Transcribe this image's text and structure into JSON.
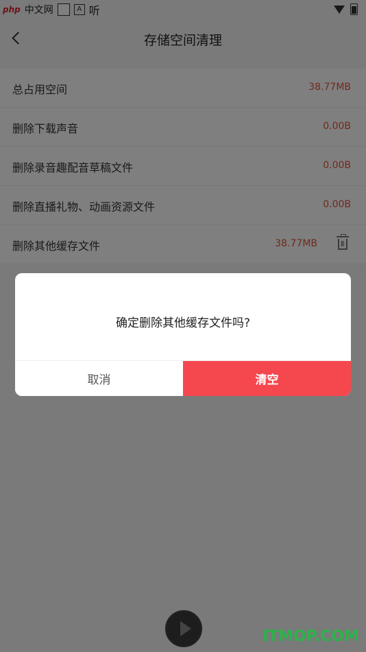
{
  "status_bar": {
    "watermark_php": "php",
    "watermark_cn": "中文网",
    "badge_a": "A",
    "listen_label": "听"
  },
  "header": {
    "title": "存储空间清理"
  },
  "storage": {
    "rows": [
      {
        "label": "总占用空间",
        "value": "38.77MB"
      },
      {
        "label": "删除下载声音",
        "value": "0.00B"
      },
      {
        "label": "删除录音趣配音草稿文件",
        "value": "0.00B"
      },
      {
        "label": "删除直播礼物、动画资源文件",
        "value": "0.00B"
      },
      {
        "label": "删除其他缓存文件",
        "value": "38.77MB"
      }
    ]
  },
  "dialog": {
    "message": "确定删除其他缓存文件吗?",
    "cancel_label": "取消",
    "confirm_label": "清空"
  },
  "watermark": {
    "itmop": "ITMOP.COM"
  },
  "colors": {
    "accent": "#f5474e",
    "value_text": "#e0533a",
    "mask": "rgba(0,0,0,0.5)"
  },
  "icons": {
    "back": "chevron-left-icon",
    "delete": "trash-icon",
    "player": "play-icon"
  }
}
